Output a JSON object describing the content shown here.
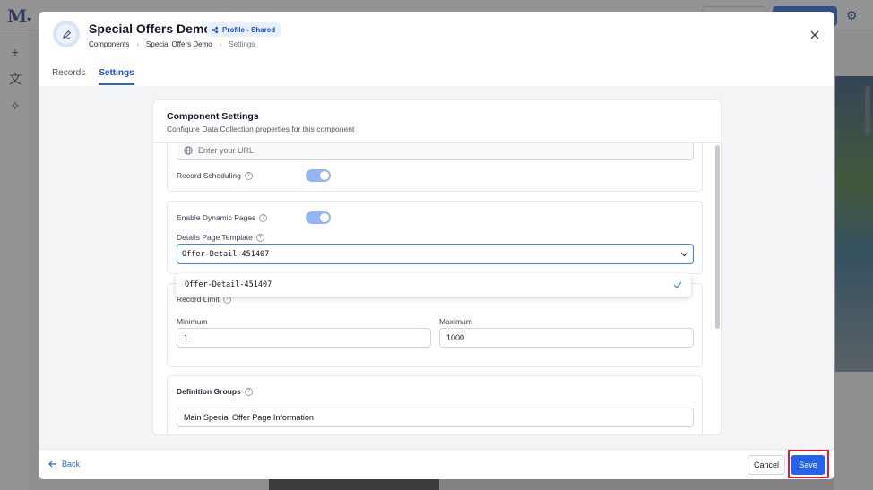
{
  "app": {
    "logo": "M",
    "logo_suffix": "▾"
  },
  "modal": {
    "title": "Special Offers Demo",
    "badge": "Profile - Shared",
    "breadcrumb": [
      "Components",
      "Special Offers Demo",
      "Settings"
    ],
    "tabs": [
      {
        "label": "Records",
        "active": false
      },
      {
        "label": "Settings",
        "active": true
      }
    ]
  },
  "card": {
    "title": "Component Settings",
    "subtitle": "Configure Data Collection properties for this component",
    "url_placeholder": "Enter your URL",
    "record_scheduling_label": "Record Scheduling",
    "record_scheduling_on": true,
    "dynamic_pages_label": "Enable Dynamic Pages",
    "dynamic_pages_on": true,
    "details_template_label": "Details Page Template",
    "details_template_value": "Offer-Detail-451407",
    "dropdown_option": "Offer-Detail-451407",
    "record_limit_label": "Record Limit",
    "minimum_label": "Minimum",
    "minimum_value": "1",
    "maximum_label": "Maximum",
    "maximum_value": "1000",
    "definition_groups_label": "Definition Groups",
    "definition_group_value": "Main Special Offer Page Information"
  },
  "footer": {
    "back_label": "Back",
    "cancel_label": "Cancel",
    "save_label": "Save"
  },
  "colors": {
    "accent": "#2563eb",
    "highlight": "#e11d2b"
  }
}
